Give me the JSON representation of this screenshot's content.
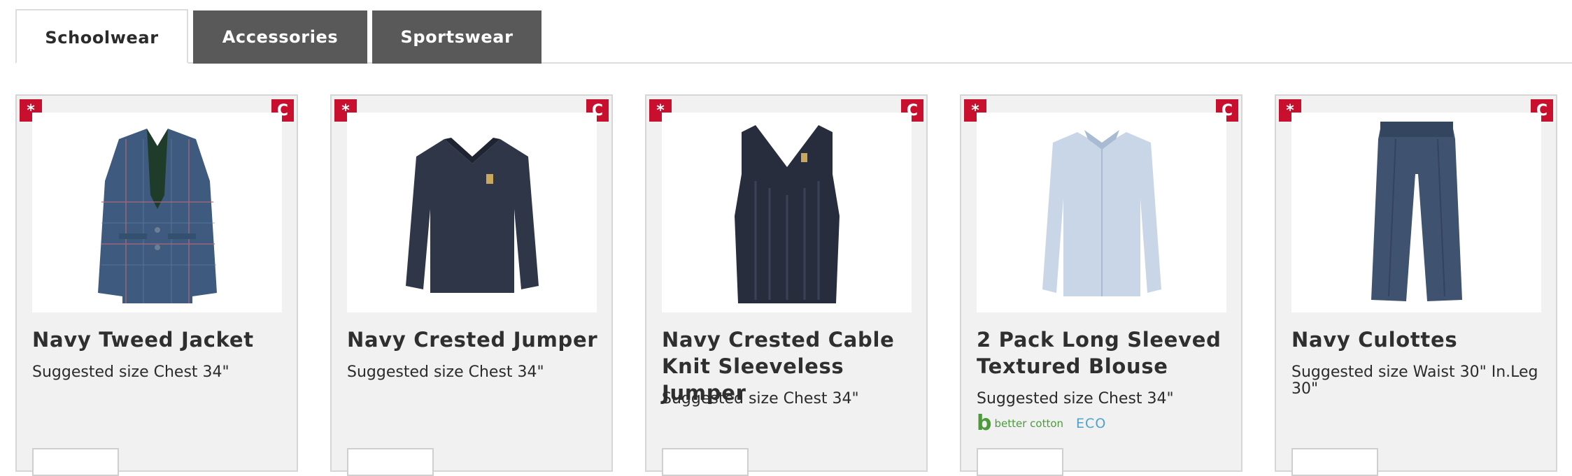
{
  "tabs": [
    {
      "label": "Schoolwear",
      "active": true
    },
    {
      "label": "Accessories",
      "active": false
    },
    {
      "label": "Sportswear",
      "active": false
    }
  ],
  "badges": {
    "left": "*",
    "right": "C"
  },
  "products": [
    {
      "title": "Navy Tweed Jacket",
      "size": "Suggested size Chest 34\"",
      "image": "tweed-jacket-image"
    },
    {
      "title": "Navy Crested Jumper",
      "size": "Suggested size Chest 34\"",
      "image": "crested-jumper-image"
    },
    {
      "title": "Navy Crested Cable Knit Sleeveless Jumper",
      "size": "Suggested size Chest 34\"",
      "image": "sleeveless-jumper-image"
    },
    {
      "title": "2 Pack Long Sleeved Textured Blouse",
      "size": "Suggested size Chest 34\"",
      "image": "blouse-image",
      "eco": {
        "better_cotton": "better cotton",
        "eco_label": "ECO"
      }
    },
    {
      "title": "Navy Culottes",
      "size": "Suggested size Waist 30\" In.Leg 30\"",
      "image": "culottes-image"
    }
  ],
  "colors": {
    "badge": "#c8102e",
    "tab_inactive": "#595959",
    "card_bg": "#f1f1f1"
  }
}
